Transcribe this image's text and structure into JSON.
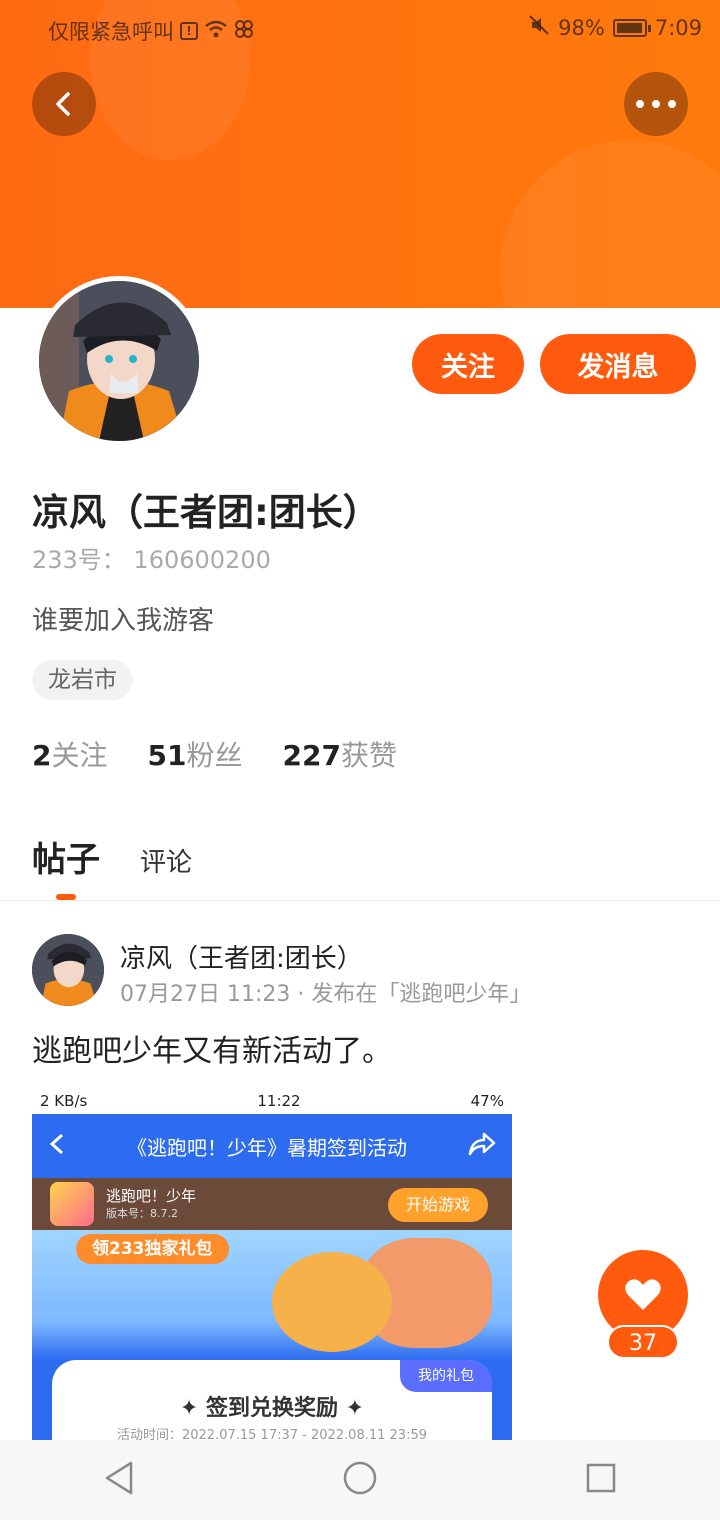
{
  "status_bar": {
    "carrier": "仅限紧急呼叫",
    "battery": "98%",
    "time": "7:09"
  },
  "profile": {
    "name": "凉风（王者团:团长）",
    "uid": "233号： 160600200",
    "bio": "谁要加入我游客",
    "location_tag": "龙岩市",
    "follow_label": "关注",
    "message_label": "发消息",
    "stats": [
      {
        "num": "2",
        "label": "关注"
      },
      {
        "num": "51",
        "label": "粉丝"
      },
      {
        "num": "227",
        "label": "获赞"
      }
    ]
  },
  "tabs": {
    "posts": "帖子",
    "comments": "评论"
  },
  "post": {
    "author": "凉风（王者团:团长）",
    "meta": "07月27日 11:23 · 发布在「逃跑吧少年」",
    "text": "逃跑吧少年又有新活动了。",
    "screenshot": {
      "status_left": "2 KB/s",
      "status_time": "11:22",
      "status_battery": "47%",
      "title": "《逃跑吧！少年》暑期签到活动",
      "game_name": "逃跑吧！少年",
      "game_version": "版本号：8.7.2",
      "start_button": "开始游戏",
      "gift_pack": "领233独家礼包",
      "my_gifts": "我的礼包",
      "card_title": "✦ 签到兑换奖励 ✦",
      "card_time": "活动时间：2022.07.15 17:37 - 2022.08.11 23:59"
    }
  },
  "like_count": "37"
}
